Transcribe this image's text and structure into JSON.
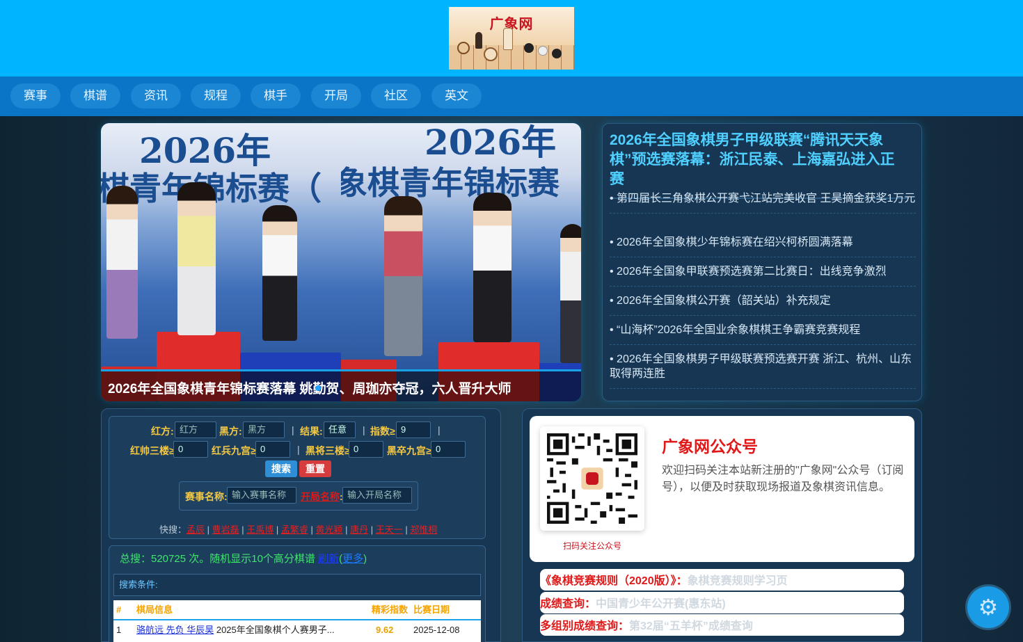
{
  "nav": {
    "items": [
      "赛事",
      "棋谱",
      "资讯",
      "规程",
      "棋手",
      "开局",
      "社区",
      "英文"
    ]
  },
  "logo": {
    "text": "广象网"
  },
  "carousel": {
    "big_text_left": "2026年",
    "sub_text_left": "棋青年锦标赛（",
    "big_text_right": "2026年",
    "sub_text_right": "象棋青年锦标赛",
    "caption": "2026年全国象棋青年锦标赛落幕 姚勤贺、周珈亦夺冠，六人晋升大师"
  },
  "news": {
    "headline": "2026年全国象棋男子甲级联赛“腾讯天天象棋”预选赛落幕：浙江民泰、上海嘉弘进入正赛",
    "items": [
      "• 第四届长三角象棋公开赛弋江站完美收官 王昊摘金获奖1万元",
      "• 2026年全国象棋少年锦标赛在绍兴柯桥圆满落幕",
      "• 2026年全国象甲联赛预选赛第二比赛日：出线竞争激烈",
      "• 2026年全国象棋公开赛（韶关站）补充规定",
      "• “山海杯”2026年全国业余象棋棋王争霸赛竞赛规程",
      "• 2026年全国象棋男子甲级联赛预选赛开赛 浙江、杭州、山东取得两连胜"
    ]
  },
  "search": {
    "red_label": "红方:",
    "red_placeholder": "红方",
    "black_label": "黑方:",
    "black_placeholder": "黑方",
    "result_label": "结果:",
    "result_value": "任意",
    "index_label": "指数≥",
    "index_value": "9",
    "red_king_label": "红帅三楼≥",
    "red_king_value": "0",
    "red_pawn_label": "红兵九宫≥",
    "red_pawn_value": "0",
    "black_king_label": "黑将三楼≥",
    "black_king_value": "0",
    "black_pawn_label": "黑卒九宫≥",
    "black_pawn_value": "0",
    "search_button": "搜索",
    "reset_button": "重置",
    "event_label": "赛事名称",
    "event_placeholder": "输入赛事名称",
    "opening_label": "开局名称",
    "opening_placeholder": "输入开局名称",
    "quick_label": "快搜：",
    "quick_links": [
      "孟辰",
      "曹岩磊",
      "王禹博",
      "孟繁睿",
      "黄光颖",
      "唐丹",
      "王天一",
      "郑惟桐"
    ],
    "stat_prefix": "总搜：520725 次。随机显示10个高分棋谱 ",
    "stat_link1": "刷新",
    "stat_link2": "更多",
    "condition": "搜索条件:",
    "table_headers": [
      "#",
      "棋局信息",
      "精彩指数",
      "比赛日期"
    ],
    "rows": [
      {
        "num": "1",
        "players": "骆航远 先负 华辰昊",
        "event": " 2025年全国象棋个人赛男子...",
        "index": "9.62",
        "date": "2025-12-08"
      }
    ]
  },
  "wechat": {
    "title": "广象网公众号",
    "description": "欢迎扫码关注本站新注册的\"广象网\"公众号（订阅号），以便及时获取现场报道及象棋资讯信息。",
    "qr_caption": "扫码关注公众号"
  },
  "rules": [
    {
      "key": "《象棋竞赛规则（2020版）》：",
      "value": "象棋竞赛规则学习页"
    },
    {
      "key": "成绩查询：",
      "value": "中国青少年公开赛(惠东站)"
    },
    {
      "key": "多组别成绩查询：",
      "value": "第32届“五羊杯”成绩查询"
    }
  ],
  "colors": {
    "header": "#00b4ff",
    "nav": "#0a74c6",
    "accent": "#4fd0ff",
    "gold": "#f5c842",
    "red": "#e01818"
  },
  "icons": {
    "fab": "gear-icon"
  }
}
